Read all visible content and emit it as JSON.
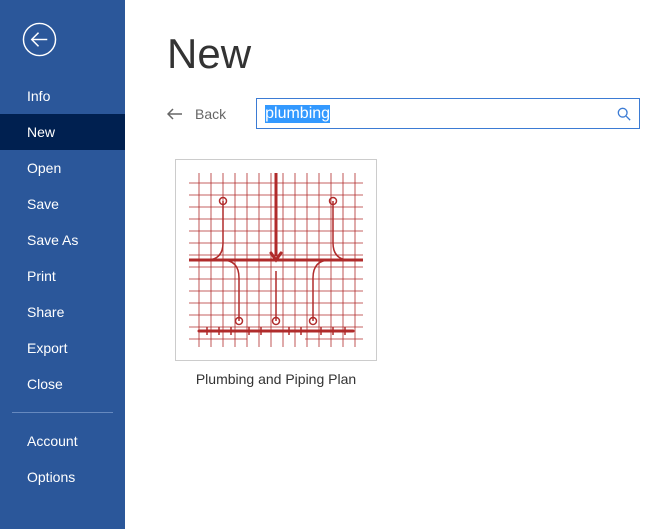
{
  "sidebar": {
    "items": [
      {
        "label": "Info"
      },
      {
        "label": "New"
      },
      {
        "label": "Open"
      },
      {
        "label": "Save"
      },
      {
        "label": "Save As"
      },
      {
        "label": "Print"
      },
      {
        "label": "Share"
      },
      {
        "label": "Export"
      },
      {
        "label": "Close"
      }
    ],
    "bottom_items": [
      {
        "label": "Account"
      },
      {
        "label": "Options"
      }
    ],
    "active_index": 1
  },
  "main": {
    "title": "New",
    "back_label": "Back",
    "search_value": "plumbing",
    "templates": [
      {
        "label": "Plumbing and Piping Plan"
      }
    ]
  },
  "colors": {
    "sidebar_bg": "#2b579a",
    "active_bg": "#002050",
    "border": "#3b7bd4",
    "diagram": "#b02b2b"
  }
}
